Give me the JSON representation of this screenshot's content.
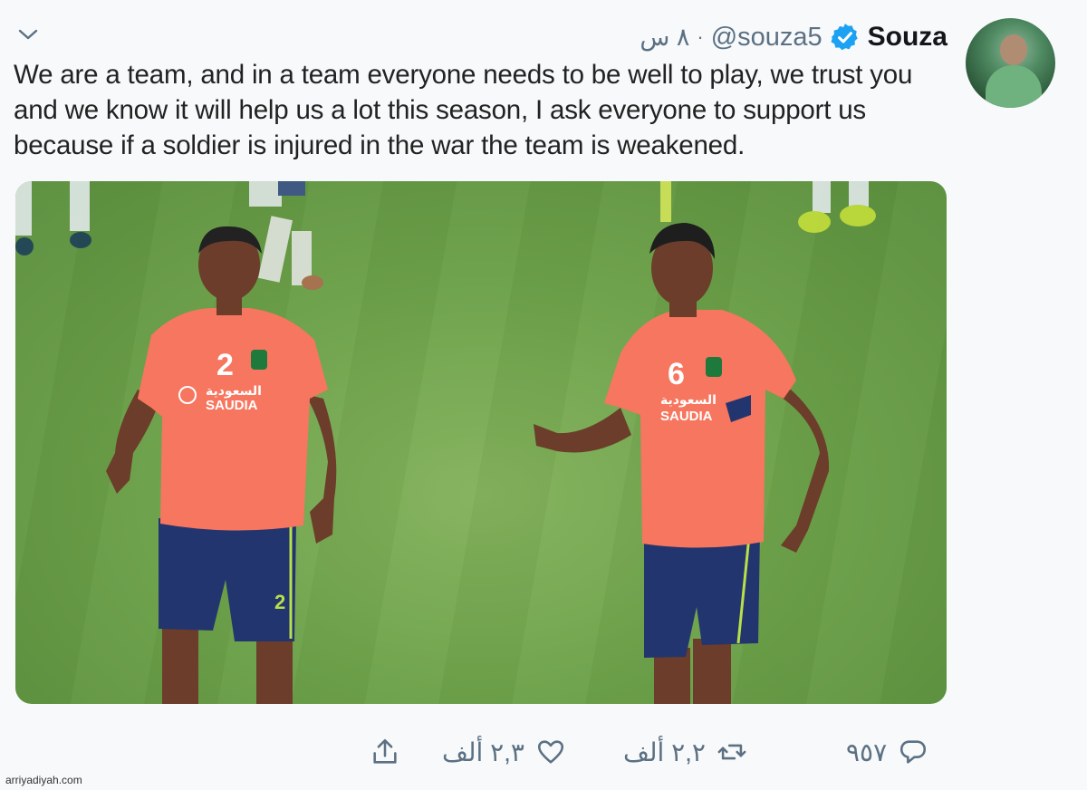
{
  "tweet": {
    "name": "Souza",
    "handle": "@souza5",
    "separator": "·",
    "time": "٨ س",
    "text": "We are a team, and in a team everyone needs to be well to play, we trust you and we know it will help us a lot this season, I ask everyone to support us because if a soldier is injured in the war the team is weakened.",
    "photo_alt": "",
    "players": [
      {
        "number": "2",
        "sponsor": "SAUDIA",
        "sponsor_ar": "السعودية",
        "shorts_number": "2"
      },
      {
        "number": "6",
        "sponsor": "SAUDIA",
        "sponsor_ar": "السعودية"
      }
    ],
    "colors": {
      "jersey": "#f7765f",
      "shorts": "#23356e",
      "pitch": "#6ea24a",
      "verified": "#1da1f2",
      "secondary_text": "#5b7083"
    }
  },
  "actions": {
    "replies": "٩٥٧",
    "retweets": "٢,٢ ألف",
    "likes": "٢,٣ ألف"
  },
  "icons": [
    "chevron-down-icon",
    "verified-badge-icon",
    "reply-icon",
    "retweet-icon",
    "like-icon",
    "share-icon"
  ],
  "watermark": "arriyadiyah.com"
}
